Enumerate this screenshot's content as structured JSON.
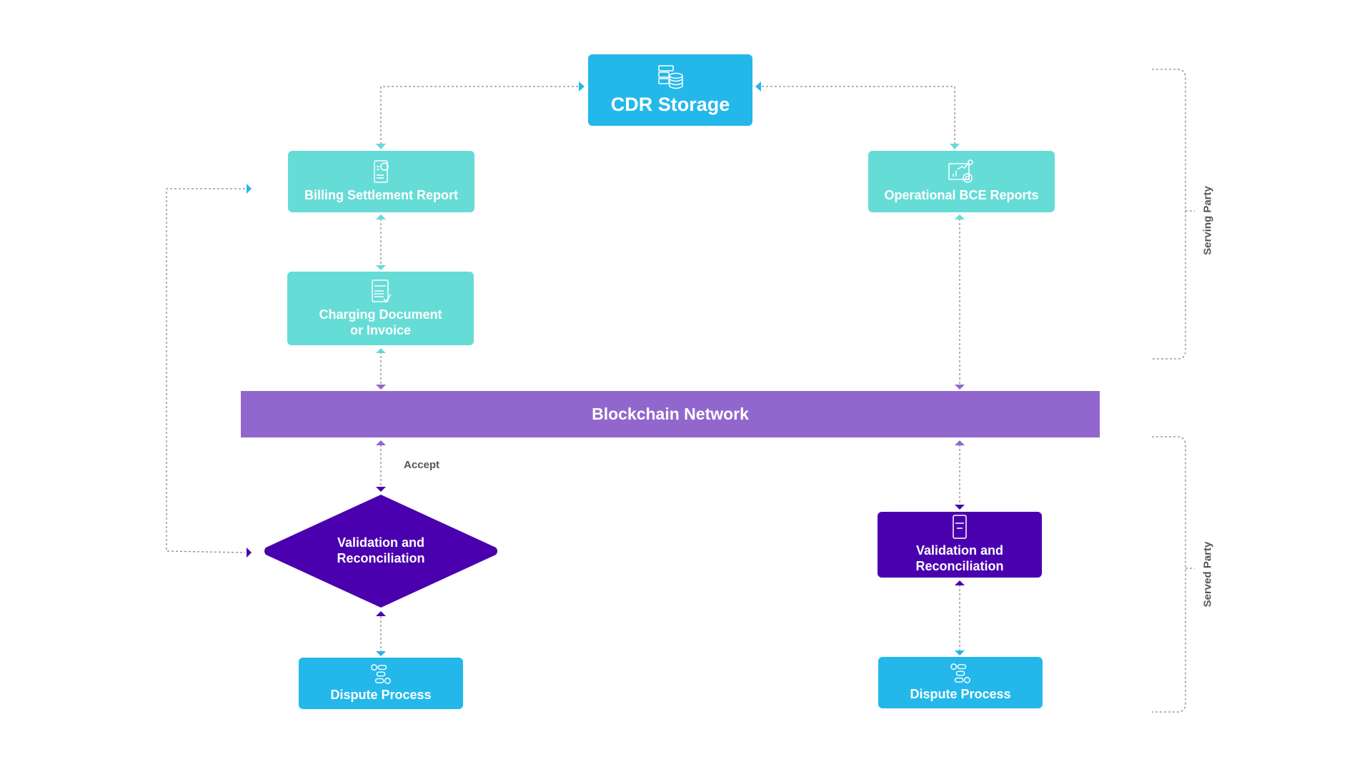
{
  "diagram": {
    "nodes": {
      "cdr_storage": {
        "label": "CDR Storage",
        "icon": "database-server-icon"
      },
      "billing_settlement_report": {
        "label": "Billing Settlement Report",
        "icon": "billing-document-icon"
      },
      "charging_document": {
        "label": "Charging Document or Invoice",
        "icon": "invoice-icon"
      },
      "operational_bce_reports": {
        "label": "Operational BCE Reports",
        "icon": "analytics-report-icon"
      },
      "blockchain_network": {
        "label": "Blockchain Network"
      },
      "validation_left": {
        "label": "Validation and Reconciliation",
        "icon": "tablet-rating-icon",
        "shape": "diamond"
      },
      "validation_right": {
        "label": "Validation and Reconciliation",
        "icon": "tablet-rating-icon"
      },
      "dispute_left": {
        "label": "Dispute Process",
        "icon": "workflow-icon"
      },
      "dispute_right": {
        "label": "Dispute Process",
        "icon": "workflow-icon"
      }
    },
    "edge_labels": {
      "accept": "Accept"
    },
    "groups": {
      "serving_party": "Serving Party",
      "served_party": "Served Party"
    },
    "colors": {
      "cyan": "#24b8ea",
      "teal": "#66dcd6",
      "blockchain": "#9267cd",
      "violet": "#4a00ae",
      "connector": "#8a8a8a"
    }
  }
}
